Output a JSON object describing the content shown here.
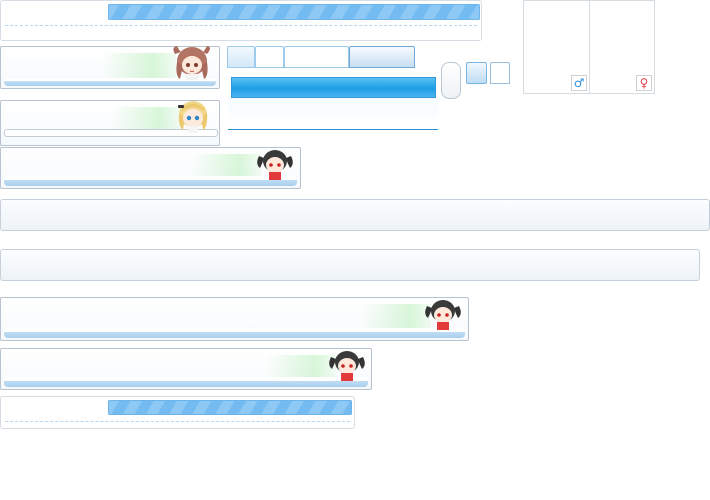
{
  "progress_panels": [
    {
      "level": 1.0
    },
    {
      "level": 1.0
    }
  ],
  "gender": {
    "male_symbol": "♂",
    "female_symbol": "♀",
    "male_color": "#2a8fdf",
    "female_color": "#e2424d"
  },
  "tabs": {
    "count": 4
  },
  "icons": {
    "avatar_brown": "chibi-brown-hair-girl",
    "avatar_blonde": "chibi-blonde-girl",
    "avatar_black": "chibi-black-twintail-girl"
  },
  "colors": {
    "accent": "#1f9ee6",
    "progress": "#8ec9f5",
    "card_border": "#b7c3cf"
  }
}
